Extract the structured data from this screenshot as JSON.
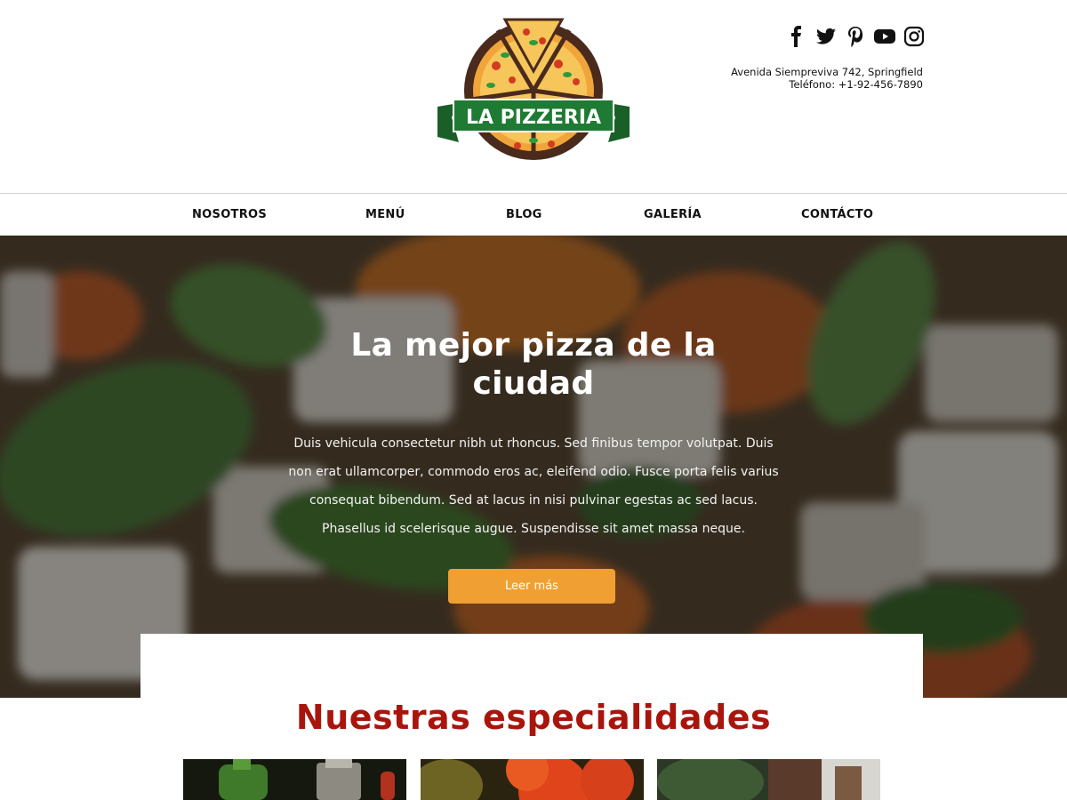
{
  "brand": {
    "logo_text": "LA PIZZERIA"
  },
  "social": [
    {
      "name": "facebook-icon"
    },
    {
      "name": "twitter-icon"
    },
    {
      "name": "pinterest-icon"
    },
    {
      "name": "youtube-icon"
    },
    {
      "name": "instagram-icon"
    }
  ],
  "contact": {
    "address": "Avenida Siempreviva 742, Springfield",
    "phone": "Teléfono: +1-92-456-7890"
  },
  "nav": {
    "items": [
      {
        "label": "NOSOTROS"
      },
      {
        "label": "MENÚ"
      },
      {
        "label": "BLOG"
      },
      {
        "label": "GALERÍA"
      },
      {
        "label": "CONTÁCTO"
      }
    ]
  },
  "hero": {
    "title_line1": "La mejor pizza de la",
    "title_line2": "ciudad",
    "text": "Duis vehicula consectetur nibh ut rhoncus. Sed finibus tempor volutpat. Duis non erat ullamcorper, commodo eros ac, eleifend odio. Fusce porta felis varius consequat bibendum. Sed at lacus in nisi pulvinar egestas ac sed lacus. Phasellus id scelerisque augue. Suspendisse sit amet massa neque.",
    "button": "Leer más"
  },
  "specialties": {
    "title": "Nuestras especialidades"
  },
  "colors": {
    "accent": "#f0a032",
    "title_red": "#a8150c",
    "logo_green": "#1f7a33"
  }
}
